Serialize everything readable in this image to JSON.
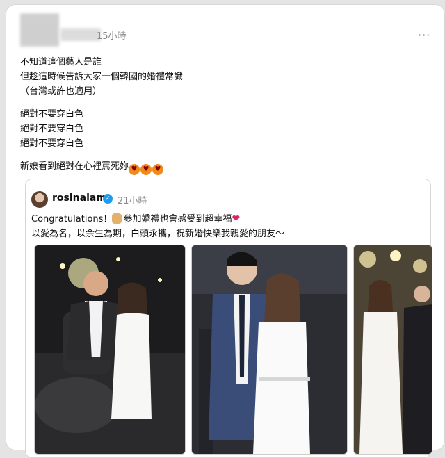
{
  "post": {
    "author_blurred": true,
    "timestamp": "15小時",
    "more_label": "···",
    "lines": [
      "不知道這個藝人是誰",
      "但趁這時候告訴大家一個韓國的婚禮常識",
      "（台灣或許也適用）",
      "絕對不要穿白色",
      "絕對不要穿白色",
      "絕對不要穿白色",
      "新娘看到絕對在心裡罵死妳"
    ],
    "emoji": "heart-eyes-emoji"
  },
  "quote": {
    "username": "rosinalam",
    "verified": true,
    "timestamp": "21小時",
    "line1_a": "Congratulations！",
    "line1_b": "參加婚禮也會感受到超幸福",
    "line2": "以愛為名，以余生為期，白頭永攜，祝新婚快樂我親愛的朋友～",
    "photos": [
      {
        "subject": "wedding-photo-couple-seated"
      },
      {
        "subject": "wedding-photo-couple-standing"
      },
      {
        "subject": "wedding-photo-partial"
      }
    ]
  },
  "colors": {
    "background": "#e4e4e4",
    "card": "#ffffff",
    "muted_text": "#8a8a8a",
    "verified": "#1d9bf0",
    "heart": "#e0245e"
  }
}
